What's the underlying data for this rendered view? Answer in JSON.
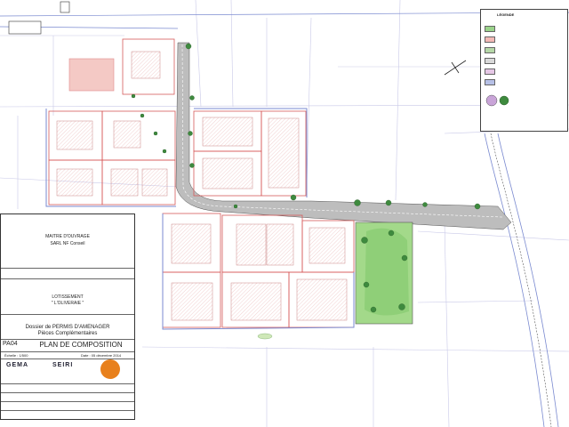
{
  "title_block": {
    "owner_heading": "MAITRE D'OUVRAGE",
    "owner_name": "SARL NF Conseil",
    "project_name": "LOTISSEMENT",
    "project_subname": "\" L'OLIVERAIE \"",
    "dossier_line1": "Dossier de PERMIS D'AMENAGER",
    "dossier_line2": "Pièces Complémentaires",
    "sheet_code": "PA04",
    "sheet_title": "PLAN DE COMPOSITION",
    "scale": "Échelle : 1/500",
    "date": "Date : 05 décembre 2014",
    "logo_1": "GEMA",
    "logo_2": "SEIRI"
  },
  "legend": {
    "title": "LÉGENDE",
    "items": [
      {
        "color": "#9ad38a"
      },
      {
        "color": "#f3b9b6"
      },
      {
        "color": "#b6d8a8"
      },
      {
        "color": "#d9d9d9"
      },
      {
        "color": "#e6c7e6"
      },
      {
        "color": "#b6c0e6"
      }
    ]
  },
  "colors": {
    "road": "#bdbdbd",
    "lot_border": "#e06c6c",
    "green_space": "#a3d98a",
    "tree": "#3e8a3e",
    "boundary": "#7a8ad0"
  }
}
